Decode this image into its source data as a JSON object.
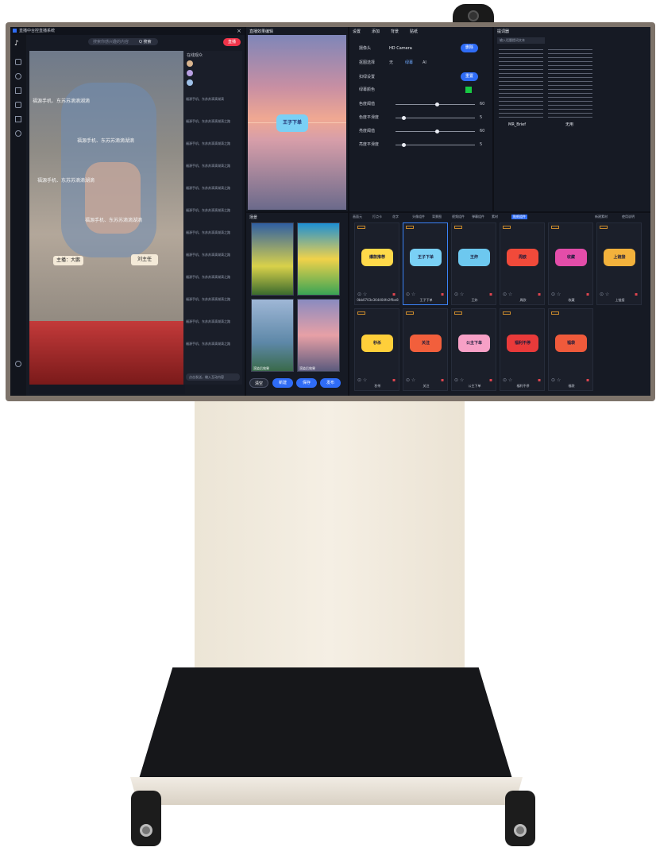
{
  "monitor": {
    "app_title": "直播中台控直播系统",
    "search_placeholder": "搜索你感兴趣的内容",
    "search_button": "Q 搜索",
    "live_button": "直播",
    "streamer_badge": "主播：大鹏",
    "host_badge": "刘主任",
    "scroll_text": "福源手机、东苏苏滴滴湖滴",
    "preview_title": "直播效果编辑",
    "sticker_text": "王子下单",
    "settings_tabs": [
      "设置",
      "添加",
      "背景",
      "贴纸"
    ],
    "settings": {
      "camera_label": "摄像头",
      "camera_value": "HD Camera",
      "delete_button": "删除",
      "cutout_label": "抠图选择",
      "cutout_options": [
        "无",
        "绿幕",
        "AI"
      ],
      "keying_label": "扣绿设置",
      "reset_button": "重置",
      "green_label": "绿幕颜色",
      "green_color": "#18c943",
      "sliders": [
        {
          "label": "色度阈值",
          "value": "60"
        },
        {
          "label": "色度平滑度",
          "value": "5"
        },
        {
          "label": "亮度阈值",
          "value": "60"
        },
        {
          "label": "亮度平滑度",
          "value": "5"
        }
      ]
    },
    "script_panel_title": "提词器",
    "script_input_placeholder": "输入话题提词文本",
    "script_columns": [
      {
        "title": "MR_Brief"
      },
      {
        "title": "无用"
      }
    ],
    "chat_title": "在线观众",
    "chat_footer": "点击发送，输入互动内容",
    "chat_lines": [
      "福源手机、东苏苏滴滴湖滴",
      "福源手机、东苏苏滴滴湖滴之路",
      "福源手机、东苏苏滴滴湖滴之路",
      "福源手机、东苏苏滴滴湖滴之路",
      "福源手机、东苏苏滴滴湖滴之路",
      "福源手机、东苏苏滴滴湖滴之路",
      "福源手机、东苏苏滴滴湖滴之路",
      "福源手机、东苏苏滴滴湖滴之路",
      "福源手机、东苏苏滴滴湖滴之路",
      "福源手机、东苏苏滴滴湖滴之路",
      "福源手机、东苏苏滴滴湖滴之路",
      "福源手机、东苏苏滴滴湖滴之路"
    ],
    "scene_title": "场景",
    "scene_buttons": [
      "清空",
      "新建",
      "保存",
      "发布"
    ],
    "scene_labels": [
      "",
      "",
      "渲染后效果",
      "渲染后效果"
    ],
    "material_tabs": [
      "画面元",
      "打点卡",
      "花字",
      "头像组件",
      "背景图",
      "视频组件",
      "弹幕组件",
      "素材",
      "贴纸组件"
    ],
    "material_right": [
      "新建素材",
      "使用说明"
    ],
    "stickers": [
      {
        "label": "0bb0703e364404fe2ffbe8",
        "bg": "#ffd94a",
        "text": "爆款推荐"
      },
      {
        "label": "王子下单",
        "bg": "#7ad0f5",
        "text": "王子下单"
      },
      {
        "label": "王炸",
        "bg": "#6dc8ef",
        "text": "王炸"
      },
      {
        "label": "周欧",
        "bg": "#f14a3a",
        "text": "周欧"
      },
      {
        "label": "收藏",
        "bg": "#e34da9",
        "text": "收藏"
      },
      {
        "label": "上链接",
        "bg": "#f3b23c",
        "text": "上链接"
      },
      {
        "label": "秒杀",
        "bg": "#ffcf3a",
        "text": "秒杀"
      },
      {
        "label": "关注",
        "bg": "#f25f3c",
        "text": "关注"
      },
      {
        "label": "公主下单",
        "bg": "#f7a0c6",
        "text": "公主下单"
      },
      {
        "label": "福利不停",
        "bg": "#e93a3a",
        "text": "福利不停"
      },
      {
        "label": "福袋",
        "bg": "#ef5a3b",
        "text": "福袋"
      }
    ]
  }
}
